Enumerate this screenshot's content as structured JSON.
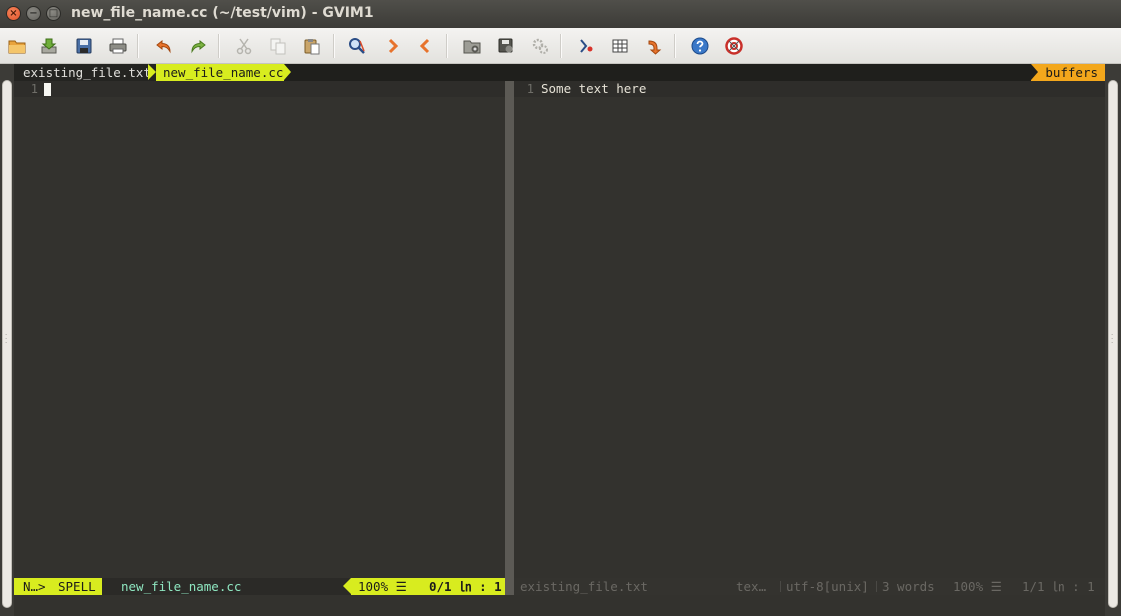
{
  "window": {
    "title": "new_file_name.cc (~/test/vim) - GVIM1",
    "close_glyph": "×",
    "minimize_glyph": "−",
    "maximize_glyph": "□"
  },
  "toolbar": {
    "items": [
      {
        "name": "open-folder-icon",
        "tooltip": "Open"
      },
      {
        "name": "save-download-icon",
        "tooltip": "Save"
      },
      {
        "name": "save-all-icon",
        "tooltip": "Save All"
      },
      {
        "name": "print-icon",
        "tooltip": "Print"
      },
      {
        "name": "undo-icon",
        "tooltip": "Undo"
      },
      {
        "name": "redo-icon",
        "tooltip": "Redo"
      },
      {
        "name": "cut-icon",
        "tooltip": "Cut"
      },
      {
        "name": "copy-icon",
        "tooltip": "Copy"
      },
      {
        "name": "paste-icon",
        "tooltip": "Paste"
      },
      {
        "name": "find-replace-icon",
        "tooltip": "Find and Replace"
      },
      {
        "name": "find-next-icon",
        "tooltip": "Find Next"
      },
      {
        "name": "find-previous-icon",
        "tooltip": "Find Previous"
      },
      {
        "name": "load-session-icon",
        "tooltip": "Load Session"
      },
      {
        "name": "save-session-icon",
        "tooltip": "Save Session"
      },
      {
        "name": "run-script-icon",
        "tooltip": "Run Script"
      },
      {
        "name": "make-icon",
        "tooltip": "Make"
      },
      {
        "name": "table-icon",
        "tooltip": "Table"
      },
      {
        "name": "jump-tag-icon",
        "tooltip": "Jump to Tag"
      },
      {
        "name": "help-icon",
        "tooltip": "Help"
      },
      {
        "name": "find-help-icon",
        "tooltip": "Find Help"
      }
    ]
  },
  "tabline": {
    "tabs": [
      {
        "label": "existing_file.txt",
        "active": false
      },
      {
        "label": "new_file_name.cc",
        "active": true
      }
    ],
    "right_label": "buffers"
  },
  "panes": {
    "left": {
      "line_number": "1",
      "text": ""
    },
    "right": {
      "line_number": "1",
      "text": "Some text here"
    }
  },
  "statusline": {
    "left": {
      "mode": "N…",
      "separator": ">",
      "spell": "SPELL",
      "filename": "new_file_name.cc",
      "percent": "100% ☰",
      "position": "0/1 ㏑ :  1"
    },
    "right": {
      "filename": "existing_file.txt",
      "filetype": "tex…",
      "encoding": "utf-8[unix]",
      "words": "3 words",
      "percent": "100% ☰",
      "position": "1/1 ㏑ :  1"
    }
  },
  "colors": {
    "accent_lime": "#d8ec1f",
    "accent_orange": "#f3a71c",
    "editor_bg": "#33322e",
    "filename_teal": "#8ee6c0"
  }
}
